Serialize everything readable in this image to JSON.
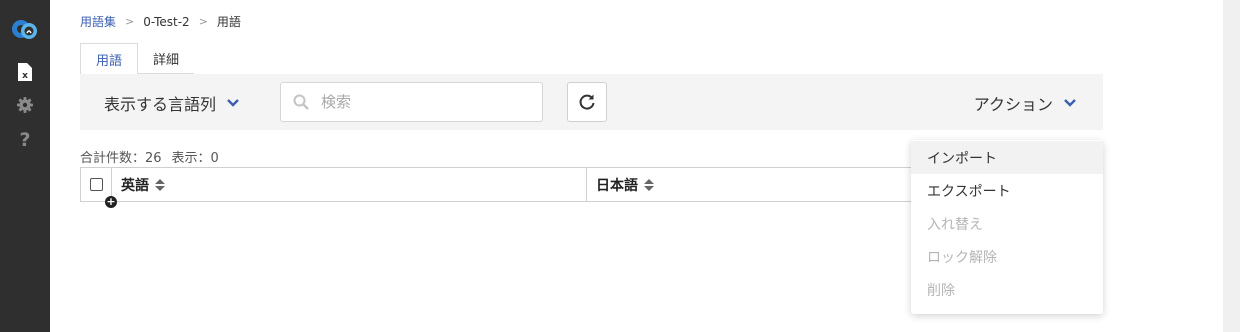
{
  "sidebar": {
    "icons": [
      "logo-icon",
      "file-excel-icon",
      "gear-icon",
      "question-icon"
    ],
    "excel_glyph": "x",
    "help_glyph": "?"
  },
  "breadcrumb": {
    "items": [
      "用語集",
      "0-Test-2",
      "用語"
    ],
    "separator": ">"
  },
  "tabs": [
    "用語",
    "詳細"
  ],
  "toolbar": {
    "language_columns_label": "表示する言語列",
    "search_placeholder": "検索",
    "action_label": "アクション"
  },
  "counts": {
    "total": "合計件数：26",
    "shown": "表示：0"
  },
  "table": {
    "columns": [
      "英語",
      "日本語"
    ]
  },
  "action_menu": {
    "items": [
      {
        "label": "インポート",
        "state": "hover"
      },
      {
        "label": "エクスポート",
        "state": "enabled"
      },
      {
        "label": "入れ替え",
        "state": "disabled"
      },
      {
        "label": "ロック解除",
        "state": "disabled"
      },
      {
        "label": "削除",
        "state": "disabled"
      }
    ]
  },
  "colors": {
    "accent": "#3b5fb0",
    "sidebar": "#2f2f2f",
    "toolbar_bg": "#f4f4f4",
    "disabled_text": "#b5b5b5"
  }
}
